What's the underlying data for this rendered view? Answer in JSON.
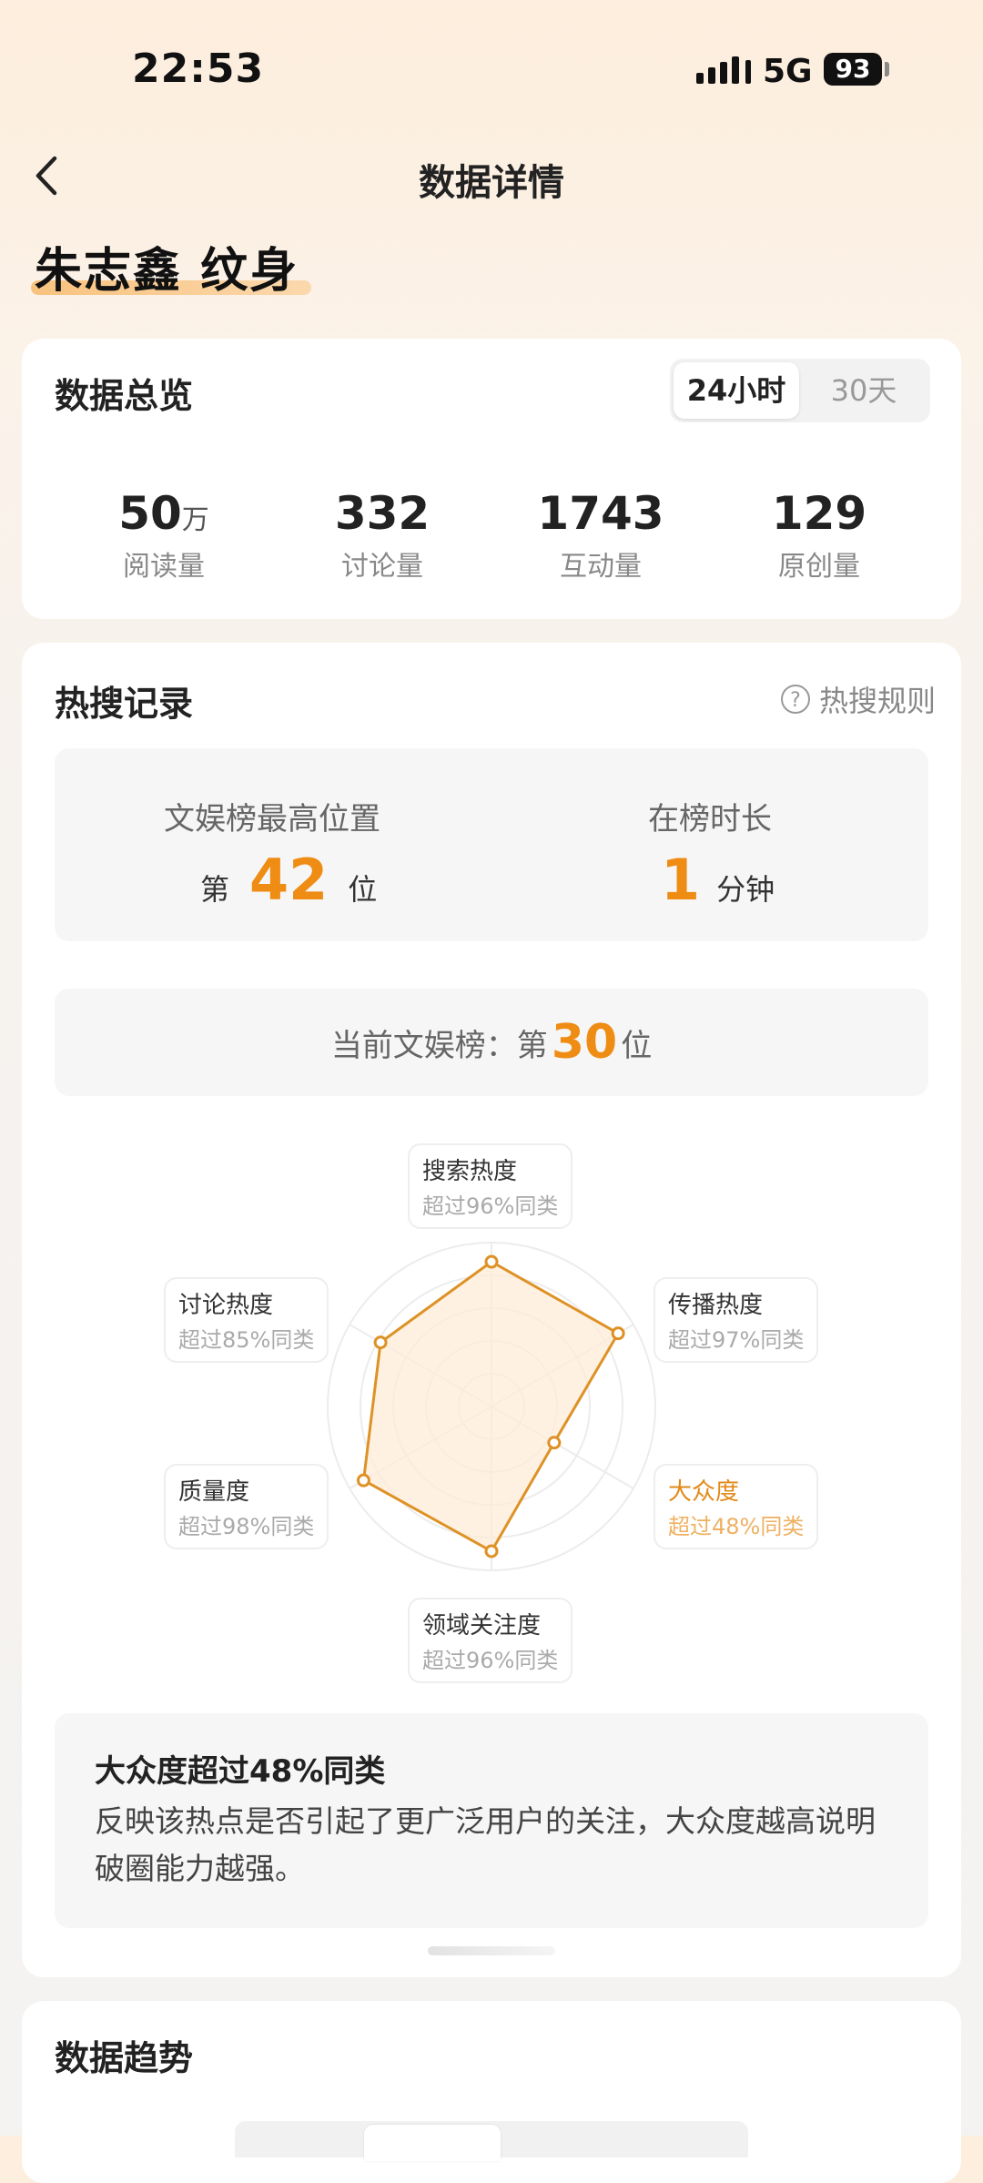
{
  "status": {
    "time": "22:53",
    "network": "5G",
    "battery": "93"
  },
  "nav": {
    "title": "数据详情"
  },
  "topic": "朱志鑫 纹身",
  "overview": {
    "title": "数据总览",
    "tabs": [
      "24小时",
      "30天"
    ],
    "stats": [
      {
        "value": "50",
        "unit": "万",
        "label": "阅读量"
      },
      {
        "value": "332",
        "unit": "",
        "label": "讨论量"
      },
      {
        "value": "1743",
        "unit": "",
        "label": "互动量"
      },
      {
        "value": "129",
        "unit": "",
        "label": "原创量"
      }
    ]
  },
  "hot": {
    "title": "热搜记录",
    "rules": "热搜规则",
    "best": {
      "label": "文娱榜最高位置",
      "prefix": "第",
      "value": "42",
      "suffix": "位"
    },
    "duration": {
      "label": "在榜时长",
      "value": "1",
      "suffix": "分钟"
    },
    "current": {
      "prefix": "当前文娱榜：第",
      "value": "30",
      "suffix": "位"
    },
    "accent_color": "#ee8c14"
  },
  "radar": {
    "axes": [
      {
        "name": "搜索热度",
        "desc": "超过96%同类",
        "value": 0.96
      },
      {
        "name": "传播热度",
        "desc": "超过97%同类",
        "value": 0.97
      },
      {
        "name": "大众度",
        "desc": "超过48%同类",
        "value": 0.48
      },
      {
        "name": "领域关注度",
        "desc": "超过96%同类",
        "value": 0.96
      },
      {
        "name": "质量度",
        "desc": "超过98%同类",
        "value": 0.98
      },
      {
        "name": "讨论热度",
        "desc": "超过85%同类",
        "value": 0.85
      }
    ],
    "selected": "大众度"
  },
  "description": {
    "title": "大众度超过48%同类",
    "text": "反映该热点是否引起了更广泛用户的关注，大众度越高说明破圈能力越强。"
  },
  "trend": {
    "title": "数据趋势"
  }
}
